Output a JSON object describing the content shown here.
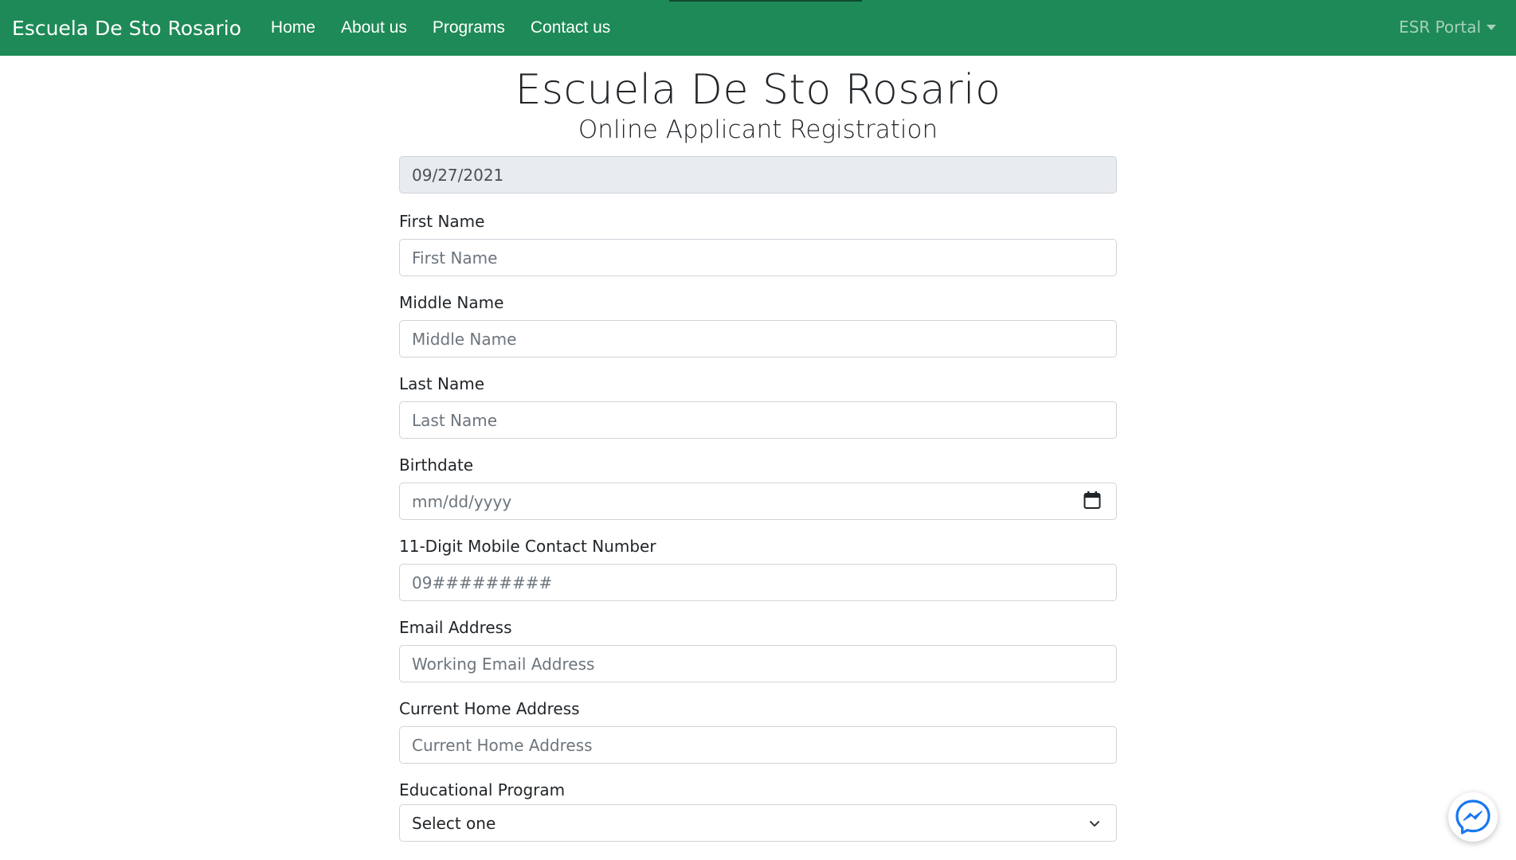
{
  "navbar": {
    "brand": "Escuela De Sto Rosario",
    "links": [
      "Home",
      "About us",
      "Programs",
      "Contact us"
    ],
    "portal_label": "ESR Portal"
  },
  "header": {
    "title": "Escuela De Sto Rosario",
    "subtitle": "Online Applicant Registration"
  },
  "form": {
    "date_value": "09/27/2021",
    "first_name": {
      "label": "First Name",
      "placeholder": "First Name"
    },
    "middle_name": {
      "label": "Middle Name",
      "placeholder": "Middle Name"
    },
    "last_name": {
      "label": "Last Name",
      "placeholder": "Last Name"
    },
    "birthdate": {
      "label": "Birthdate",
      "placeholder": "mm/dd/yyyy"
    },
    "mobile": {
      "label": "11-Digit Mobile Contact Number",
      "placeholder": "09#########"
    },
    "email": {
      "label": "Email Address",
      "placeholder": "Working Email Address"
    },
    "address": {
      "label": "Current Home Address",
      "placeholder": "Current Home Address"
    },
    "program": {
      "label": "Educational Program",
      "selected": "Select one"
    }
  },
  "icons": {
    "calendar": "calendar-icon",
    "chevron": "chevron-down-icon",
    "messenger": "messenger-icon"
  },
  "colors": {
    "navbar": "#1e8a57",
    "messenger": "#1877f2"
  }
}
